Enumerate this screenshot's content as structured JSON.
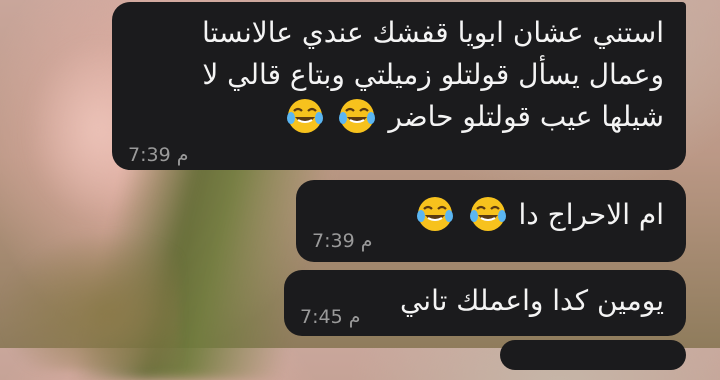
{
  "messages": [
    {
      "lines": [
        "استني عشان ابويا قفشك عندي عالانستا",
        "وعمال يسأل قولتلو زميلتي وبتاع قالي لا",
        "شيلها عيب قولتلو حاضر"
      ],
      "time": "7:39 م",
      "emoji": [
        "face-with-tears-of-joy-icon",
        "face-with-tears-of-joy-icon"
      ]
    },
    {
      "lines": [
        "ام الاحراج دا"
      ],
      "time": "7:39 م",
      "emoji": [
        "face-with-tears-of-joy-icon",
        "face-with-tears-of-joy-icon"
      ]
    },
    {
      "lines": [
        "يومين كدا واعملك تاني"
      ],
      "time": "7:45 م"
    }
  ],
  "colors": {
    "bubble": "#1b1b1d",
    "text": "#f4f4f4",
    "time": "#9a9a9a"
  }
}
